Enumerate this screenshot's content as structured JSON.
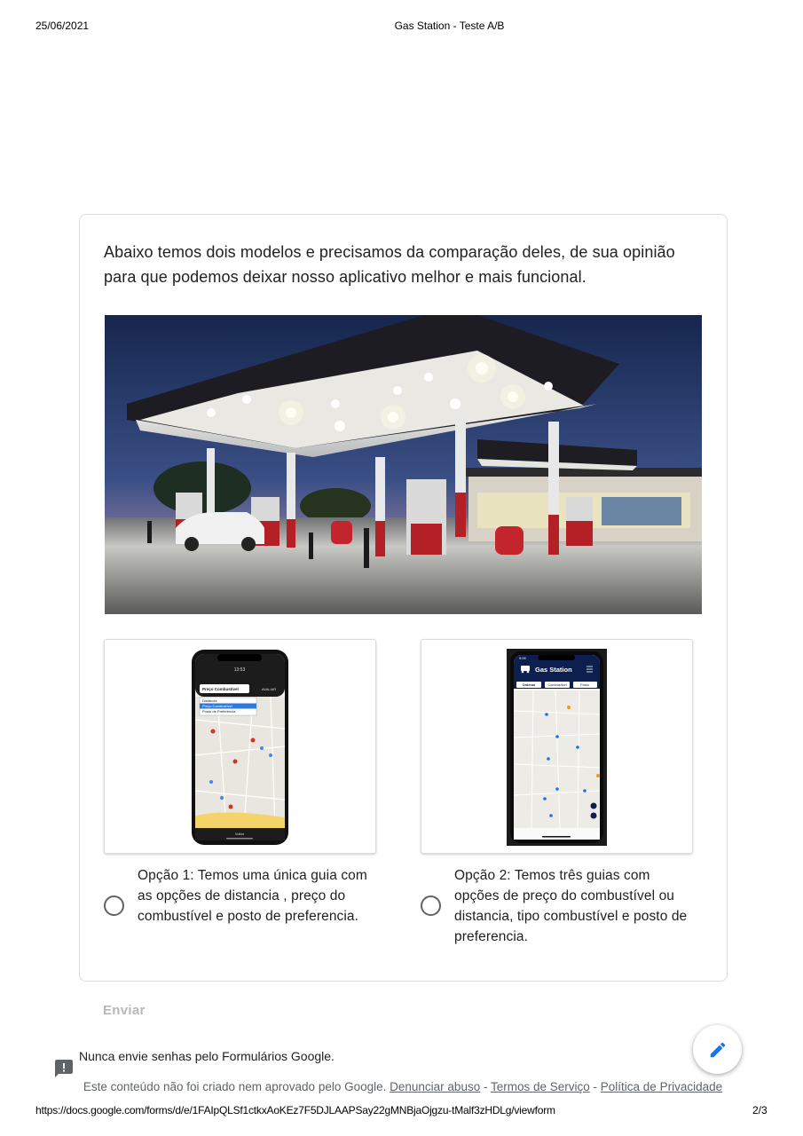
{
  "print_header": {
    "date": "25/06/2021",
    "title": "Gas Station - Teste A/B"
  },
  "print_footer": {
    "url": "https://docs.google.com/forms/d/e/1FAIpQLSf1ctkxAoKEz7F5DJLAAPSay22gMNBjaOjgzu-tMalf3zHDLg/viewform",
    "page": "2/3"
  },
  "question": {
    "text": "Abaixo temos dois modelos e precisamos da comparação deles, de sua opinião para que podemos deixar nosso aplicativo melhor e mais funcional."
  },
  "options": [
    {
      "label": "Opção 1: Temos uma única guia com as opções de distancia , preço do combustível e posto de preferencia.",
      "selected": false,
      "screenshot": {
        "status_time": "13:53",
        "dropdown_value": "Preço Combustível",
        "action_label": "AVALIAR",
        "menu_items": [
          "Distância",
          "Preço Combustível",
          "Posto de Preferência"
        ],
        "bottom_button": "Voltar"
      }
    },
    {
      "label": "Opção 2: Temos três guias com opções de preço do combustível ou distancia, tipo combustível e posto de preferencia.",
      "selected": false,
      "screenshot": {
        "status_time": "9:09",
        "app_title": "Gas Station",
        "tabs": [
          "Ordenar",
          "Combustível",
          "Posto"
        ]
      }
    }
  ],
  "submit_label": "Enviar",
  "password_warning": "Nunca envie senhas pelo Formulários Google.",
  "footer": {
    "disclaimer": "Este conteúdo não foi criado nem aprovado pelo Google.",
    "report_abuse": "Denunciar abuso",
    "separator": " - ",
    "terms": "Termos de Serviço",
    "privacy": "Política de Privacidade"
  },
  "colors": {
    "accent": "#1a73e8",
    "radio_border": "#5f6368",
    "card_border": "#dadce0",
    "app2_header": "#0d1f4f"
  },
  "icons": {
    "edit": "pencil-icon",
    "report": "feedback-icon"
  }
}
